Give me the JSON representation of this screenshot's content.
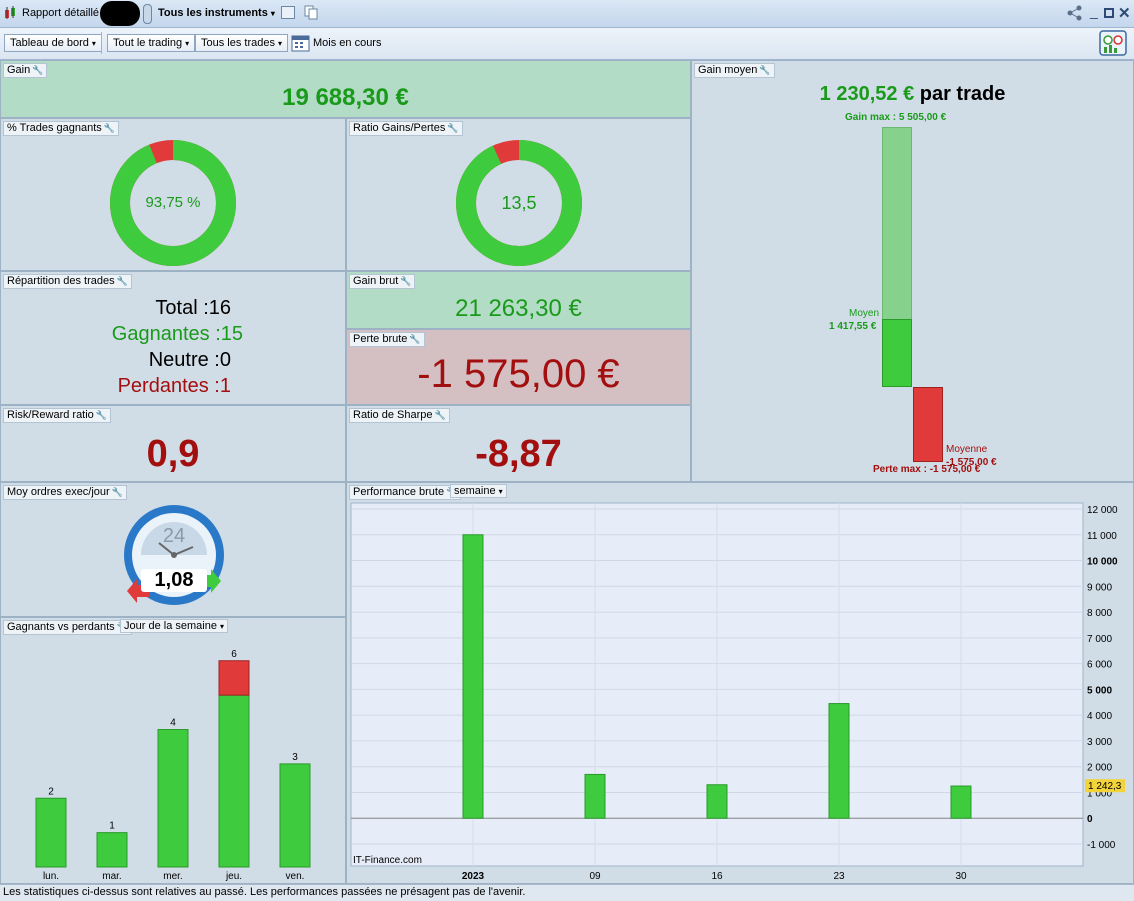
{
  "window": {
    "report_title": "Rapport détaillé",
    "instruments_label": "Tous les instruments",
    "window_controls": [
      "share-icon",
      "minimize-icon",
      "maximize-icon",
      "close-icon"
    ]
  },
  "toolbar": {
    "dashboard_label": "Tableau de bord",
    "trading_label": "Tout le trading",
    "trades_label": "Tous les trades",
    "period_label": "Mois en cours"
  },
  "gain": {
    "title": "Gain",
    "value": "19 688,30 €"
  },
  "avg_gain": {
    "title": "Gain moyen",
    "value": "1 230,52 €",
    "suffix": "par trade",
    "max_gain_label": "Gain max : 5 505,00 €",
    "avg_label": "Moyen",
    "avg_value": "1 417,55 €",
    "avg_loss_label": "Moyenne",
    "avg_loss_value": "-1 575,00 €",
    "max_loss_label": "Perte max : -1 575,00 €"
  },
  "win_pct": {
    "title": "% Trades gagnants",
    "value": "93,75 %",
    "win_fraction": 0.9375
  },
  "ratio": {
    "title": "Ratio Gains/Pertes",
    "value": "13,5",
    "win_fraction": 0.931
  },
  "distribution": {
    "title": "Répartition des trades",
    "total_label": "Total :",
    "total_value": "16",
    "win_label": "Gagnantes :",
    "win_value": "15",
    "neutral_label": "Neutre :",
    "neutral_value": "0",
    "loss_label": "Perdantes :",
    "loss_value": "1"
  },
  "gross_gain": {
    "title": "Gain brut",
    "value": "21 263,30 €"
  },
  "gross_loss": {
    "title": "Perte brute",
    "value": "-1 575,00 €"
  },
  "risk_reward": {
    "title": "Risk/Reward ratio",
    "value": "0,9"
  },
  "sharpe": {
    "title": "Ratio de Sharpe",
    "value": "-8,87"
  },
  "orders": {
    "title": "Moy ordres exec/jour",
    "clock_label": "24",
    "value": "1,08"
  },
  "weekday": {
    "title": "Gagnants vs perdants",
    "selector": "Jour de la semaine"
  },
  "performance": {
    "title": "Performance brute",
    "selector": "semaine",
    "watermark": "IT-Finance.com",
    "current_value": "1 242,3"
  },
  "footer": {
    "text": "Les statistiques ci-dessus sont relatives au passé. Les performances passées ne présagent pas de l'avenir."
  },
  "colors": {
    "green": "#3ecb3e",
    "red": "#e03a3a",
    "dark_red": "#a30f0f",
    "dark_green": "#1a9a1a"
  },
  "chart_data": [
    {
      "type": "bar",
      "title": "Gagnants vs perdants",
      "categories": [
        "lun.",
        "mar.",
        "mer.",
        "jeu.",
        "ven."
      ],
      "series": [
        {
          "name": "Gagnants",
          "values": [
            2,
            1,
            4,
            5,
            3
          ]
        },
        {
          "name": "Perdants",
          "values": [
            0,
            0,
            0,
            1,
            0
          ]
        }
      ],
      "totals": [
        2,
        1,
        4,
        6,
        3
      ],
      "ylim": [
        0,
        6.4
      ]
    },
    {
      "type": "bar",
      "title": "Performance brute",
      "categories": [
        "2023",
        "09",
        "16",
        "23",
        "30"
      ],
      "values": [
        11000,
        1700,
        1300,
        4450,
        1250
      ],
      "yticks": [
        "12 000",
        "11 000",
        "10 000",
        "9 000",
        "8 000",
        "7 000",
        "6 000",
        "5 000",
        "4 000",
        "3 000",
        "2 000",
        "1 000",
        "0",
        "-1 000"
      ],
      "ylim": [
        -1000,
        12000
      ]
    }
  ]
}
